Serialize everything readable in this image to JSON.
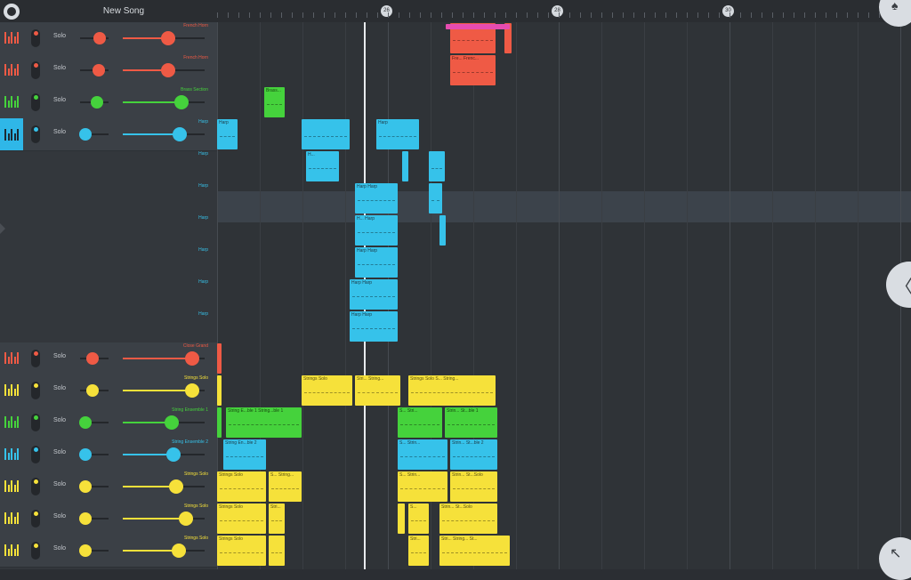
{
  "header": {
    "song_title": "New Song",
    "markers": [
      "26",
      "28",
      "30"
    ]
  },
  "colors": {
    "red": "#ef5a45",
    "green": "#45d23c",
    "blue": "#36c2ea",
    "yellow": "#f6e13a",
    "magenta": "#e64cb0"
  },
  "solo_label": "Solo",
  "tracks": [
    {
      "name": "French Horn",
      "color": "red",
      "controls": true,
      "pan": 0.7,
      "vol": 0.55
    },
    {
      "name": "French Horn",
      "color": "red",
      "controls": true,
      "pan": 0.65,
      "vol": 0.55
    },
    {
      "name": "Brass Section",
      "color": "green",
      "controls": true,
      "pan": 0.6,
      "vol": 0.72
    },
    {
      "name": "Harp",
      "color": "blue",
      "controls": true,
      "pan": 0.2,
      "vol": 0.7,
      "selected": true
    },
    {
      "name": "Harp",
      "color": "blue",
      "controls": false
    },
    {
      "name": "Harp",
      "color": "blue",
      "controls": false
    },
    {
      "name": "Harp",
      "color": "blue",
      "controls": false
    },
    {
      "name": "Harp",
      "color": "blue",
      "controls": false
    },
    {
      "name": "Harp",
      "color": "blue",
      "controls": false
    },
    {
      "name": "Harp",
      "color": "blue",
      "controls": false
    },
    {
      "name": "Close Grand",
      "color": "red",
      "controls": true,
      "pan": 0.45,
      "vol": 0.85
    },
    {
      "name": "Strings Solo",
      "color": "yellow",
      "controls": true,
      "pan": 0.45,
      "vol": 0.85
    },
    {
      "name": "String Ensemble 1",
      "color": "green",
      "controls": true,
      "pan": 0.2,
      "vol": 0.6
    },
    {
      "name": "String Ensemble 2",
      "color": "blue",
      "controls": true,
      "pan": 0.2,
      "vol": 0.62
    },
    {
      "name": "Strings Solo",
      "color": "yellow",
      "controls": true,
      "pan": 0.2,
      "vol": 0.65
    },
    {
      "name": "Strings Solo",
      "color": "yellow",
      "controls": true,
      "pan": 0.2,
      "vol": 0.77
    },
    {
      "name": "Strings Solo",
      "color": "yellow",
      "controls": true,
      "pan": 0.2,
      "vol": 0.68
    }
  ],
  "clips": [
    {
      "track": 0,
      "start": 506,
      "end": 557,
      "color": "red",
      "label": "Fre... Frenc..."
    },
    {
      "track": 0,
      "start": 567,
      "end": 575,
      "color": "red",
      "label": ""
    },
    {
      "track": 1,
      "start": 506,
      "end": 557,
      "color": "red",
      "label": "Fre... Frenc..."
    },
    {
      "track": 2,
      "start": 297,
      "end": 320,
      "color": "green",
      "label": "Brass..."
    },
    {
      "track": 3,
      "start": 244,
      "end": 267,
      "color": "blue",
      "label": "Harp"
    },
    {
      "track": 3,
      "start": 339,
      "end": 393,
      "color": "blue",
      "label": ""
    },
    {
      "track": 3,
      "start": 423,
      "end": 471,
      "color": "blue",
      "label": "Harp"
    },
    {
      "track": 4,
      "start": 344,
      "end": 381,
      "color": "blue",
      "label": "H..."
    },
    {
      "track": 4,
      "start": 452,
      "end": 459,
      "color": "blue",
      "label": ""
    },
    {
      "track": 4,
      "start": 482,
      "end": 500,
      "color": "blue",
      "label": ""
    },
    {
      "track": 5,
      "start": 399,
      "end": 447,
      "color": "blue",
      "label": "Harp   Harp"
    },
    {
      "track": 5,
      "start": 482,
      "end": 497,
      "color": "blue",
      "label": ""
    },
    {
      "track": 6,
      "start": 399,
      "end": 447,
      "color": "blue",
      "label": "H...   Harp"
    },
    {
      "track": 6,
      "start": 494,
      "end": 501,
      "color": "blue",
      "label": ""
    },
    {
      "track": 7,
      "start": 399,
      "end": 447,
      "color": "blue",
      "label": "Harp  Harp"
    },
    {
      "track": 8,
      "start": 393,
      "end": 447,
      "color": "blue",
      "label": "Harp    Harp"
    },
    {
      "track": 9,
      "start": 393,
      "end": 447,
      "color": "blue",
      "label": "Harp    Harp"
    },
    {
      "track": 10,
      "start": 244,
      "end": 249,
      "color": "red",
      "label": ""
    },
    {
      "track": 11,
      "start": 244,
      "end": 249,
      "color": "yellow",
      "label": ""
    },
    {
      "track": 11,
      "start": 339,
      "end": 396,
      "color": "yellow",
      "label": "Strings Solo"
    },
    {
      "track": 11,
      "start": 399,
      "end": 450,
      "color": "yellow",
      "label": "Stri... String..."
    },
    {
      "track": 11,
      "start": 459,
      "end": 557,
      "color": "yellow",
      "label": "Strings Solo  S...  String..."
    },
    {
      "track": 12,
      "start": 244,
      "end": 249,
      "color": "green",
      "label": ""
    },
    {
      "track": 12,
      "start": 254,
      "end": 339,
      "color": "green",
      "label": "String E...ble 1  String...ble 1"
    },
    {
      "track": 12,
      "start": 447,
      "end": 497,
      "color": "green",
      "label": "S...  Stri..."
    },
    {
      "track": 12,
      "start": 500,
      "end": 559,
      "color": "green",
      "label": "Strin...  St...ble 1"
    },
    {
      "track": 13,
      "start": 251,
      "end": 299,
      "color": "blue",
      "label": "String En...ble 2"
    },
    {
      "track": 13,
      "start": 447,
      "end": 503,
      "color": "blue",
      "label": "S...  Strin..."
    },
    {
      "track": 13,
      "start": 506,
      "end": 559,
      "color": "blue",
      "label": "Strin...  St...ble 2"
    },
    {
      "track": 14,
      "start": 244,
      "end": 299,
      "color": "yellow",
      "label": "Strings Solo"
    },
    {
      "track": 14,
      "start": 302,
      "end": 339,
      "color": "yellow",
      "label": "S...  String..."
    },
    {
      "track": 14,
      "start": 447,
      "end": 503,
      "color": "yellow",
      "label": "S...  Strin..."
    },
    {
      "track": 14,
      "start": 506,
      "end": 559,
      "color": "yellow",
      "label": "Strin...  St...Solo"
    },
    {
      "track": 15,
      "start": 244,
      "end": 299,
      "color": "yellow",
      "label": "Strings Solo"
    },
    {
      "track": 15,
      "start": 302,
      "end": 320,
      "color": "yellow",
      "label": "Stri..."
    },
    {
      "track": 15,
      "start": 447,
      "end": 455,
      "color": "yellow",
      "label": ""
    },
    {
      "track": 15,
      "start": 459,
      "end": 482,
      "color": "yellow",
      "label": "S..."
    },
    {
      "track": 15,
      "start": 494,
      "end": 559,
      "color": "yellow",
      "label": "Strin...  St...Solo"
    },
    {
      "track": 16,
      "start": 244,
      "end": 299,
      "color": "yellow",
      "label": "Strings Solo"
    },
    {
      "track": 16,
      "start": 302,
      "end": 320,
      "color": "yellow",
      "label": ""
    },
    {
      "track": 16,
      "start": 459,
      "end": 482,
      "color": "yellow",
      "label": "Stri..."
    },
    {
      "track": 16,
      "start": 494,
      "end": 573,
      "color": "yellow",
      "label": "Stri...  String...  St..."
    }
  ]
}
